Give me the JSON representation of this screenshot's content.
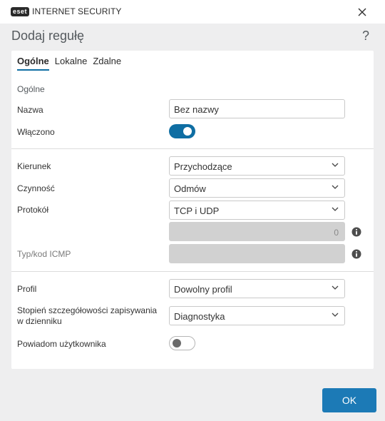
{
  "window": {
    "logo_badge": "eset",
    "logo_text": "INTERNET SECURITY"
  },
  "dialog": {
    "title": "Dodaj regułę",
    "help": "?"
  },
  "tabs": [
    {
      "label": "Ogólne",
      "active": true
    },
    {
      "label": "Lokalne",
      "active": false
    },
    {
      "label": "Zdalne",
      "active": false
    }
  ],
  "general": {
    "section_label": "Ogólne",
    "name_label": "Nazwa",
    "name_value": "Bez nazwy",
    "enabled_label": "Włączono",
    "enabled": true
  },
  "rule": {
    "direction_label": "Kierunek",
    "direction_value": "Przychodzące",
    "action_label": "Czynność",
    "action_value": "Odmów",
    "protocol_label": "Protokół",
    "protocol_value": "TCP i UDP",
    "protocol_number": "0",
    "icmp_label": "Typ/kod ICMP",
    "icmp_value": ""
  },
  "profile": {
    "profile_label": "Profil",
    "profile_value": "Dowolny profil",
    "log_label_line1": "Stopień szczegółowości zapisywania",
    "log_label_line2": "w dzienniku",
    "log_value": "Diagnostyka",
    "notify_label": "Powiadom użytkownika",
    "notify": false
  },
  "footer": {
    "ok_label": "OK"
  },
  "colors": {
    "accent": "#0f6ea3",
    "ok_button": "#1c7ab6",
    "background": "#eeeeef"
  }
}
